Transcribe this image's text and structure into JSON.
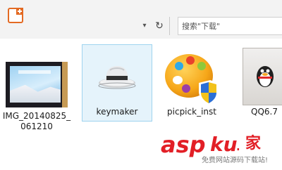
{
  "toolbar": {
    "search_placeholder": "搜索\"下载\""
  },
  "files": [
    {
      "name": "IMG_20140825_061210",
      "line1": "IMG_20140825_",
      "line2": "061210",
      "icon": "photo-thumbnail",
      "selected": false
    },
    {
      "name": "keymaker",
      "line1": "keymaker",
      "icon": "fedora-hat-icon",
      "selected": true
    },
    {
      "name": "picpick_inst",
      "line1": "picpick_inst",
      "icon": "palette-shield-icon",
      "selected": false
    },
    {
      "name": "QQ6.7",
      "line1": "QQ6.7",
      "icon": "qq-penguin-icon",
      "selected": false
    }
  ],
  "watermark": {
    "brand": "asp",
    "domain": "ku",
    "dot": ".",
    "site": "家",
    "tagline": "免费网站源码下载站!"
  },
  "colors": {
    "toolbar_bg": "#f3f3f3",
    "selection_bg": "#e5f3fb",
    "selection_border": "#9fd4ef",
    "watermark_red": "#e21f26"
  }
}
